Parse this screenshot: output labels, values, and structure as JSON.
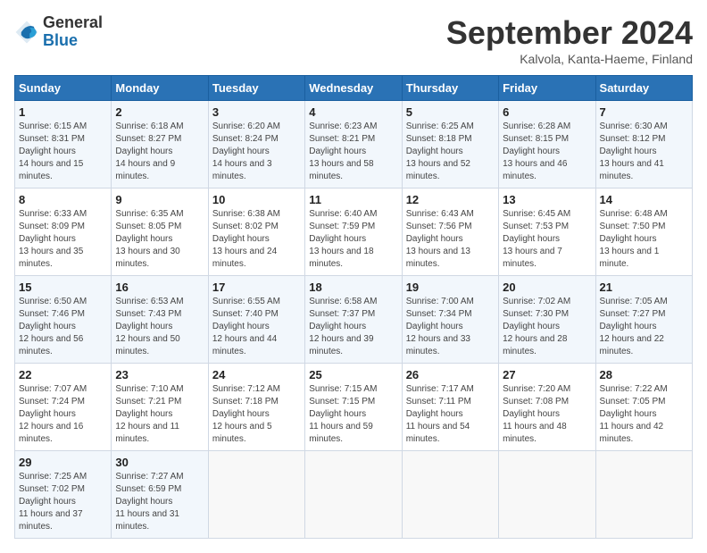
{
  "header": {
    "logo_general": "General",
    "logo_blue": "Blue",
    "month_title": "September 2024",
    "subtitle": "Kalvola, Kanta-Haeme, Finland"
  },
  "days_of_week": [
    "Sunday",
    "Monday",
    "Tuesday",
    "Wednesday",
    "Thursday",
    "Friday",
    "Saturday"
  ],
  "weeks": [
    [
      {
        "day": "1",
        "sunrise": "6:15 AM",
        "sunset": "8:31 PM",
        "daylight": "14 hours and 15 minutes."
      },
      {
        "day": "2",
        "sunrise": "6:18 AM",
        "sunset": "8:27 PM",
        "daylight": "14 hours and 9 minutes."
      },
      {
        "day": "3",
        "sunrise": "6:20 AM",
        "sunset": "8:24 PM",
        "daylight": "14 hours and 3 minutes."
      },
      {
        "day": "4",
        "sunrise": "6:23 AM",
        "sunset": "8:21 PM",
        "daylight": "13 hours and 58 minutes."
      },
      {
        "day": "5",
        "sunrise": "6:25 AM",
        "sunset": "8:18 PM",
        "daylight": "13 hours and 52 minutes."
      },
      {
        "day": "6",
        "sunrise": "6:28 AM",
        "sunset": "8:15 PM",
        "daylight": "13 hours and 46 minutes."
      },
      {
        "day": "7",
        "sunrise": "6:30 AM",
        "sunset": "8:12 PM",
        "daylight": "13 hours and 41 minutes."
      }
    ],
    [
      {
        "day": "8",
        "sunrise": "6:33 AM",
        "sunset": "8:09 PM",
        "daylight": "13 hours and 35 minutes."
      },
      {
        "day": "9",
        "sunrise": "6:35 AM",
        "sunset": "8:05 PM",
        "daylight": "13 hours and 30 minutes."
      },
      {
        "day": "10",
        "sunrise": "6:38 AM",
        "sunset": "8:02 PM",
        "daylight": "13 hours and 24 minutes."
      },
      {
        "day": "11",
        "sunrise": "6:40 AM",
        "sunset": "7:59 PM",
        "daylight": "13 hours and 18 minutes."
      },
      {
        "day": "12",
        "sunrise": "6:43 AM",
        "sunset": "7:56 PM",
        "daylight": "13 hours and 13 minutes."
      },
      {
        "day": "13",
        "sunrise": "6:45 AM",
        "sunset": "7:53 PM",
        "daylight": "13 hours and 7 minutes."
      },
      {
        "day": "14",
        "sunrise": "6:48 AM",
        "sunset": "7:50 PM",
        "daylight": "13 hours and 1 minute."
      }
    ],
    [
      {
        "day": "15",
        "sunrise": "6:50 AM",
        "sunset": "7:46 PM",
        "daylight": "12 hours and 56 minutes."
      },
      {
        "day": "16",
        "sunrise": "6:53 AM",
        "sunset": "7:43 PM",
        "daylight": "12 hours and 50 minutes."
      },
      {
        "day": "17",
        "sunrise": "6:55 AM",
        "sunset": "7:40 PM",
        "daylight": "12 hours and 44 minutes."
      },
      {
        "day": "18",
        "sunrise": "6:58 AM",
        "sunset": "7:37 PM",
        "daylight": "12 hours and 39 minutes."
      },
      {
        "day": "19",
        "sunrise": "7:00 AM",
        "sunset": "7:34 PM",
        "daylight": "12 hours and 33 minutes."
      },
      {
        "day": "20",
        "sunrise": "7:02 AM",
        "sunset": "7:30 PM",
        "daylight": "12 hours and 28 minutes."
      },
      {
        "day": "21",
        "sunrise": "7:05 AM",
        "sunset": "7:27 PM",
        "daylight": "12 hours and 22 minutes."
      }
    ],
    [
      {
        "day": "22",
        "sunrise": "7:07 AM",
        "sunset": "7:24 PM",
        "daylight": "12 hours and 16 minutes."
      },
      {
        "day": "23",
        "sunrise": "7:10 AM",
        "sunset": "7:21 PM",
        "daylight": "12 hours and 11 minutes."
      },
      {
        "day": "24",
        "sunrise": "7:12 AM",
        "sunset": "7:18 PM",
        "daylight": "12 hours and 5 minutes."
      },
      {
        "day": "25",
        "sunrise": "7:15 AM",
        "sunset": "7:15 PM",
        "daylight": "11 hours and 59 minutes."
      },
      {
        "day": "26",
        "sunrise": "7:17 AM",
        "sunset": "7:11 PM",
        "daylight": "11 hours and 54 minutes."
      },
      {
        "day": "27",
        "sunrise": "7:20 AM",
        "sunset": "7:08 PM",
        "daylight": "11 hours and 48 minutes."
      },
      {
        "day": "28",
        "sunrise": "7:22 AM",
        "sunset": "7:05 PM",
        "daylight": "11 hours and 42 minutes."
      }
    ],
    [
      {
        "day": "29",
        "sunrise": "7:25 AM",
        "sunset": "7:02 PM",
        "daylight": "11 hours and 37 minutes."
      },
      {
        "day": "30",
        "sunrise": "7:27 AM",
        "sunset": "6:59 PM",
        "daylight": "11 hours and 31 minutes."
      },
      null,
      null,
      null,
      null,
      null
    ]
  ]
}
